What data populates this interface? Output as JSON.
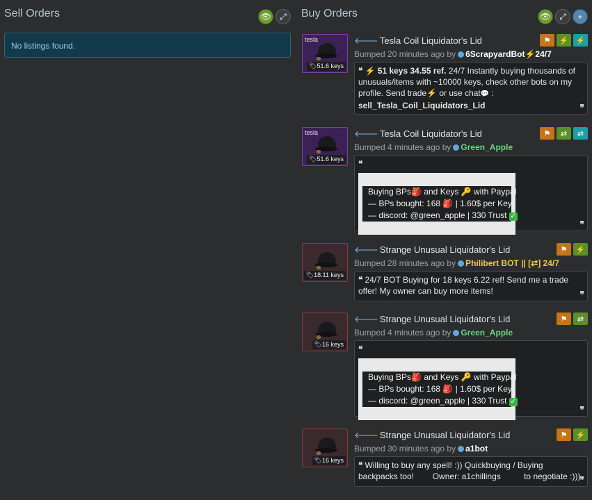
{
  "sell": {
    "title": "Sell Orders",
    "empty_text": "No listings found."
  },
  "buy": {
    "title": "Buy Orders"
  },
  "header_icons": {
    "toggle": "eye-icon",
    "expand": "expand-icon",
    "add": "plus-icon"
  },
  "listings": [
    {
      "tag": "tesla",
      "price": "51.6 keys",
      "title": "Tesla Coil Liquidator's Lid",
      "bumped": "Bumped 20 minutes ago by",
      "user": "6ScrapyardBot",
      "user_suffix": "24/7",
      "lead": "51 keys 34.55 ref.",
      "body1": " 24/7 Instantly buying thousands of unusuals/items with ~10000 keys, check other bots on my profile. Send ",
      "send_trade": "trade",
      "or_use": " or  use  ",
      "chat": "chat",
      "colon": " :",
      "cmd": "sell_Tesla_Coil_Liquidators_Lid"
    },
    {
      "tag": "tesla",
      "price": "51.6 keys",
      "title": "Tesla Coil Liquidator's Lid",
      "bumped": "Bumped 4 minutes ago by",
      "user": "Green_Apple",
      "lines": [
        "Buying BPs",
        " and Keys ",
        " with Paypal",
        "— BPs bought: 168 ",
        " | 1.60$ per Key",
        "— discord: @green_apple | 330 Trust "
      ]
    },
    {
      "tag": "",
      "price": "18.11 keys",
      "title": "Strange Unusual Liquidator's Lid",
      "bumped": "Bumped 28 minutes ago by",
      "user": "Philibert BOT || [⇄] 24/7",
      "comment": "24/7 BOT Buying for 18 keys 6.22 ref! Send me a trade offer! My owner can buy more items!"
    },
    {
      "tag": "",
      "price": "16 keys",
      "title": "Strange Unusual Liquidator's Lid",
      "bumped": "Bumped 4 minutes ago by",
      "user": "Green_Apple",
      "lines": [
        "Buying BPs",
        " and Keys ",
        " with Paypal",
        "— BPs bought: 168 ",
        " | 1.60$ per Key",
        "— discord: @green_apple | 330 Trust "
      ]
    },
    {
      "tag": "",
      "price": "16 keys",
      "title": "Strange Unusual Liquidator's Lid",
      "bumped": "Bumped 30 minutes ago by",
      "user": "a1bot",
      "comment": "Willing to buy any spell! :)) Quickbuying / Buying backpacks too!        Owner: a1chillings          to negotiate :)))"
    }
  ],
  "colors": {
    "background": "#2b2d2e",
    "info_bg": "#123a4a",
    "badge_orange": "#c87318",
    "badge_green": "#5c8f2a",
    "badge_teal": "#1aa0a6",
    "user_green": "#6fd37f",
    "user_gold": "#f0c94a"
  }
}
